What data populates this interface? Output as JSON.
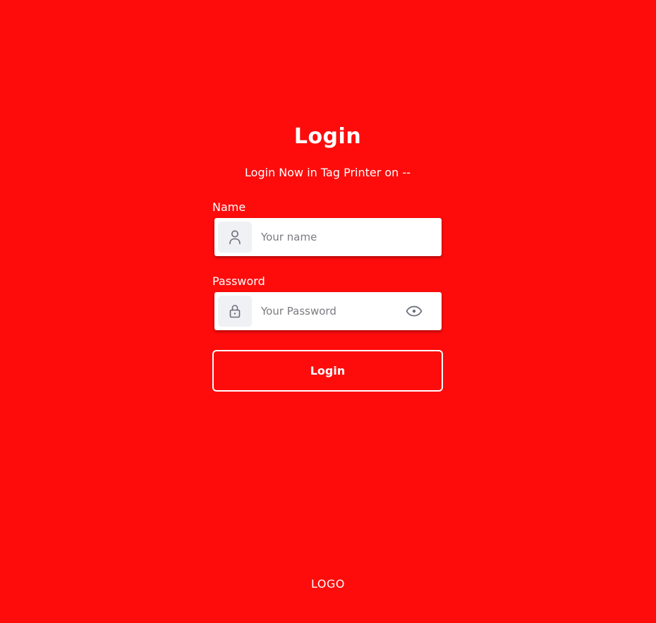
{
  "login": {
    "title": "Login",
    "subtitle": "Login Now in Tag Printer on --",
    "name_label": "Name",
    "name_placeholder": "Your name",
    "password_label": "Password",
    "password_placeholder": "Your Password",
    "button_label": "Login"
  },
  "footer": {
    "logo_text": "LOGO"
  },
  "icons": {
    "name_field": "user-icon",
    "password_field": "lock-icon",
    "password_toggle": "eye-icon"
  },
  "colors": {
    "background": "#fe0c0c",
    "text": "#ffffff",
    "input_background": "#ffffff",
    "icon_background": "#f0f1f5",
    "icon_color": "#6b6e78",
    "placeholder": "#7a7b80"
  }
}
